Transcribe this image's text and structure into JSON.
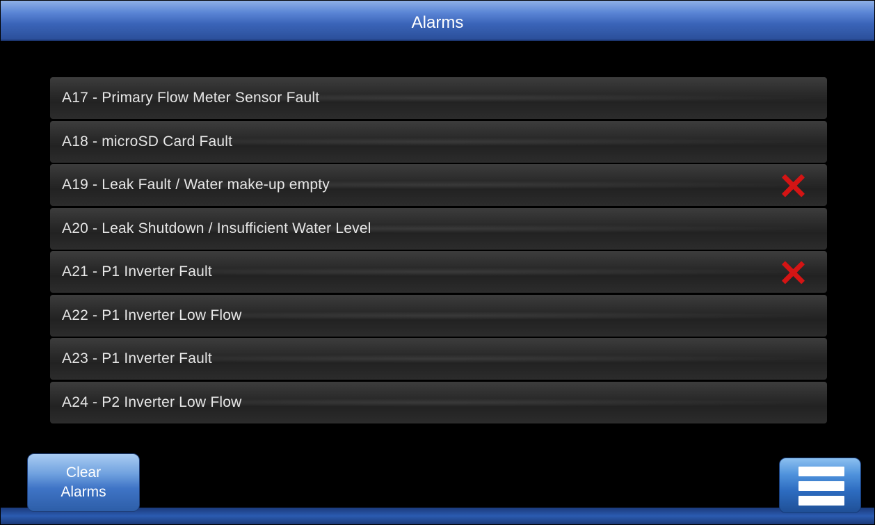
{
  "header": {
    "title": "Alarms"
  },
  "alarms": [
    {
      "label": "A17 - Primary Flow Meter Sensor Fault",
      "active": false
    },
    {
      "label": "A18 - microSD Card Fault",
      "active": false
    },
    {
      "label": "A19 - Leak Fault / Water make-up empty",
      "active": true
    },
    {
      "label": "A20 - Leak Shutdown / Insufficient Water Level",
      "active": false
    },
    {
      "label": "A21 - P1 Inverter Fault",
      "active": true
    },
    {
      "label": "A22 - P1 Inverter Low Flow",
      "active": false
    },
    {
      "label": "A23 - P1 Inverter Fault",
      "active": false
    },
    {
      "label": "A24 - P2 Inverter Low Flow",
      "active": false
    }
  ],
  "buttons": {
    "clear_line1": "Clear",
    "clear_line2": "Alarms"
  },
  "icons": {
    "active_alarm": "close-icon",
    "menu": "hamburger-menu-icon"
  },
  "colors": {
    "header_blue": "#3a64b8",
    "active_x_red": "#d41414",
    "row_bg": "#2a2a2a"
  }
}
